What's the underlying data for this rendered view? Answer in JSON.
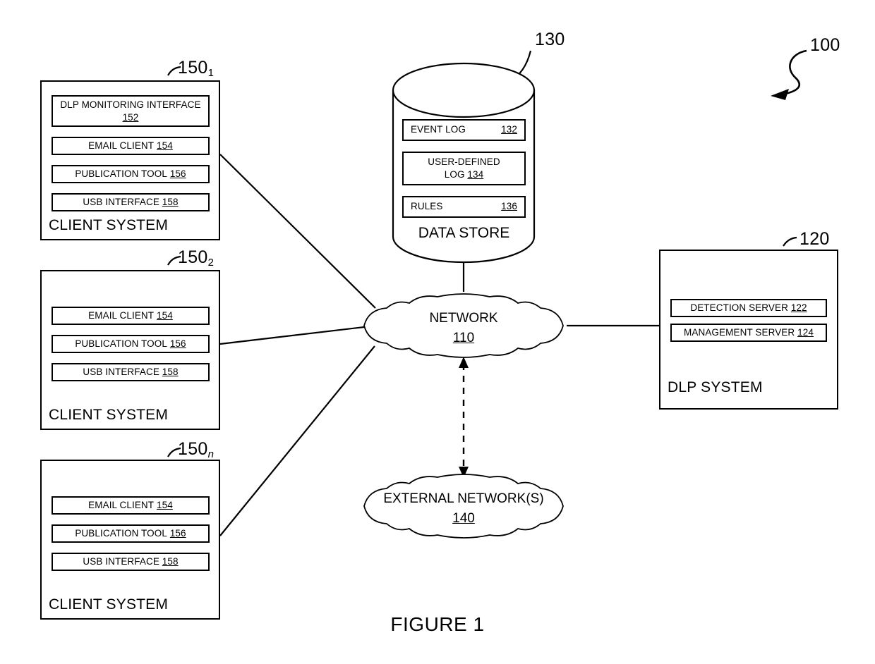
{
  "figure": {
    "caption": "FIGURE 1",
    "system_callout": "100"
  },
  "clients": [
    {
      "callout": "150",
      "subscript": "1",
      "title": "CLIENT SYSTEM",
      "modules": [
        {
          "label": "DLP MONITORING INTERFACE",
          "ref": "152",
          "style": "two-line"
        },
        {
          "label": "EMAIL CLIENT",
          "ref": "154",
          "style": "inline"
        },
        {
          "label": "PUBLICATION TOOL",
          "ref": "156",
          "style": "inline"
        },
        {
          "label": "USB INTERFACE",
          "ref": "158",
          "style": "inline"
        }
      ]
    },
    {
      "callout": "150",
      "subscript": "2",
      "title": "CLIENT SYSTEM",
      "modules": [
        {
          "label": "EMAIL CLIENT",
          "ref": "154",
          "style": "inline"
        },
        {
          "label": "PUBLICATION TOOL",
          "ref": "156",
          "style": "inline"
        },
        {
          "label": "USB INTERFACE",
          "ref": "158",
          "style": "inline"
        }
      ]
    },
    {
      "callout": "150",
      "subscript": "n",
      "subscript_italic": true,
      "title": "CLIENT SYSTEM",
      "modules": [
        {
          "label": "EMAIL CLIENT",
          "ref": "154",
          "style": "inline"
        },
        {
          "label": "PUBLICATION TOOL",
          "ref": "156",
          "style": "inline"
        },
        {
          "label": "USB INTERFACE",
          "ref": "158",
          "style": "inline"
        }
      ]
    }
  ],
  "datastore": {
    "callout": "130",
    "title": "DATA STORE",
    "modules": [
      {
        "label": "EVENT LOG",
        "ref": "132",
        "style": "split"
      },
      {
        "label": "USER-DEFINED",
        "label2": "LOG",
        "ref": "134",
        "style": "two-line"
      },
      {
        "label": "RULES",
        "ref": "136",
        "style": "split"
      }
    ]
  },
  "network": {
    "name": "NETWORK",
    "ref": "110"
  },
  "external_network": {
    "name": "EXTERNAL NETWORK(S)",
    "ref": "140"
  },
  "dlp_system": {
    "callout": "120",
    "title": "DLP SYSTEM",
    "modules": [
      {
        "label": "DETECTION SERVER",
        "ref": "122",
        "style": "inline"
      },
      {
        "label": "MANAGEMENT SERVER",
        "ref": "124",
        "style": "inline"
      }
    ]
  },
  "colors": {
    "stroke": "#000000",
    "background": "#ffffff"
  }
}
